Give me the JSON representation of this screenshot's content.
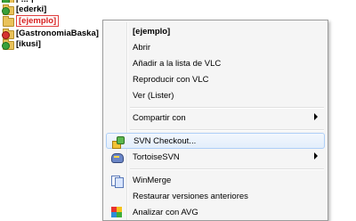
{
  "file_list": {
    "rows": [
      {
        "name": "[ ... ]",
        "status": "ok"
      },
      {
        "name": "[ederki]",
        "status": "ok"
      },
      {
        "name": "[ejemplo]",
        "status": "selected"
      },
      {
        "name": "[GastronomiaBaska]",
        "status": "modified"
      },
      {
        "name": "[ikusi]",
        "status": "ok"
      }
    ]
  },
  "context_menu": {
    "header": "[ejemplo]",
    "items": [
      {
        "label": "Abrir"
      },
      {
        "label": "Añadir a la lista de VLC"
      },
      {
        "label": "Reproducir con VLC"
      },
      {
        "label": "Ver (Lister)"
      },
      {
        "label": "Compartir con",
        "submenu": true
      },
      {
        "label": "SVN Checkout...",
        "icon": "svn-checkout-icon",
        "highlighted": true
      },
      {
        "label": "TortoiseSVN",
        "icon": "tortoisesvn-icon",
        "submenu": true
      },
      {
        "label": "WinMerge",
        "icon": "winmerge-icon"
      },
      {
        "label": "Restaurar versiones anteriores"
      },
      {
        "label": "Analizar con AVG",
        "icon": "avg-icon"
      }
    ]
  },
  "colors": {
    "selected_text": "#d81e1e",
    "highlight_border": "#aecff7",
    "menu_background": "#f5f5f5"
  }
}
